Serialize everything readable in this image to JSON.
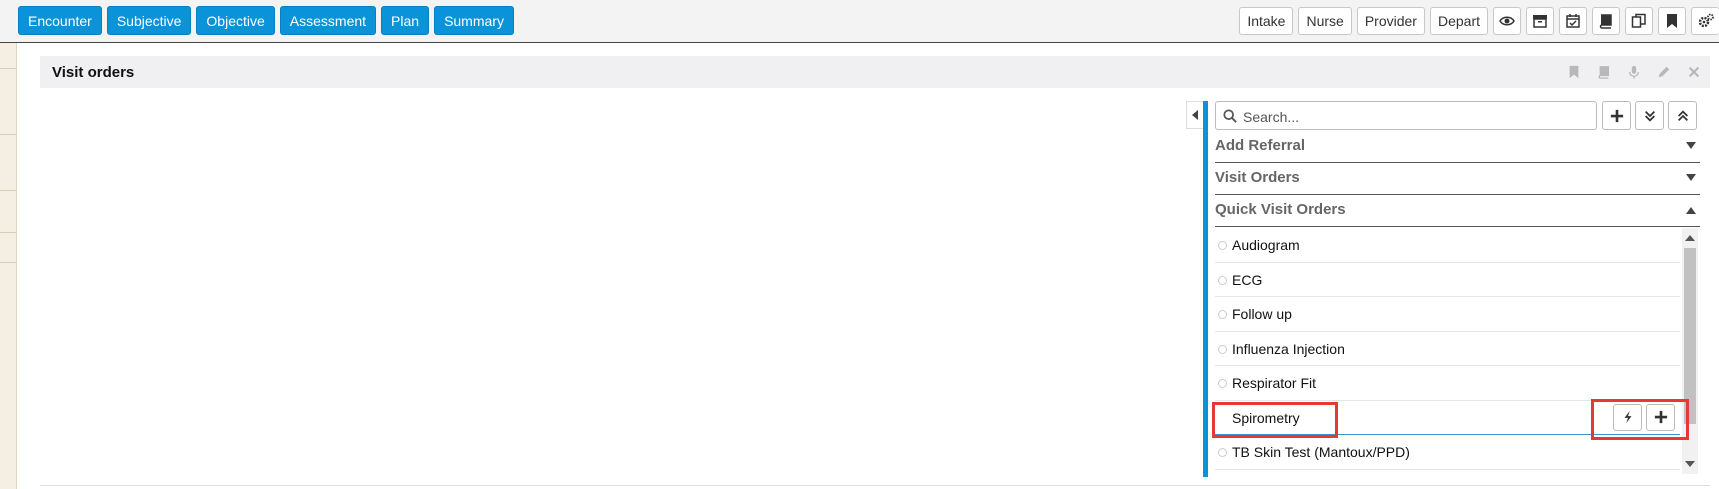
{
  "topbar": {
    "tabs": [
      {
        "label": "Encounter"
      },
      {
        "label": "Subjective"
      },
      {
        "label": "Objective"
      },
      {
        "label": "Assessment"
      },
      {
        "label": "Plan"
      },
      {
        "label": "Summary"
      }
    ],
    "role_buttons": [
      {
        "label": "Intake"
      },
      {
        "label": "Nurse"
      },
      {
        "label": "Provider"
      },
      {
        "label": "Depart"
      }
    ],
    "icon_buttons": [
      "eye-icon",
      "archive-icon",
      "calendar-check-icon",
      "book-icon",
      "copy-icon",
      "bookmark-icon",
      "gears-icon"
    ]
  },
  "panel": {
    "title": "Visit orders",
    "header_icons": [
      "bookmark-icon",
      "book-icon",
      "microphone-icon",
      "pencil-icon",
      "close-icon"
    ]
  },
  "sidebar": {
    "search": {
      "placeholder": "Search...",
      "value": ""
    },
    "actions": [
      "add-icon",
      "expand-all-icon",
      "collapse-all-icon"
    ],
    "sections": [
      {
        "label": "Add Referral",
        "state": "collapsed"
      },
      {
        "label": "Visit Orders",
        "state": "collapsed"
      },
      {
        "label": "Quick Visit Orders",
        "state": "expanded"
      }
    ],
    "quick_orders": [
      {
        "label": "Audiogram"
      },
      {
        "label": "ECG"
      },
      {
        "label": "Follow up"
      },
      {
        "label": "Influenza Injection"
      },
      {
        "label": "Respirator Fit"
      },
      {
        "label": "Spirometry",
        "hovered": true
      },
      {
        "label": "TB Skin Test (Mantoux/PPD)"
      }
    ],
    "item_actions": [
      "lightning-icon",
      "add-icon"
    ]
  },
  "colors": {
    "accent": "#0b93d9",
    "highlight": "#e53935",
    "section_text": "#666666"
  }
}
